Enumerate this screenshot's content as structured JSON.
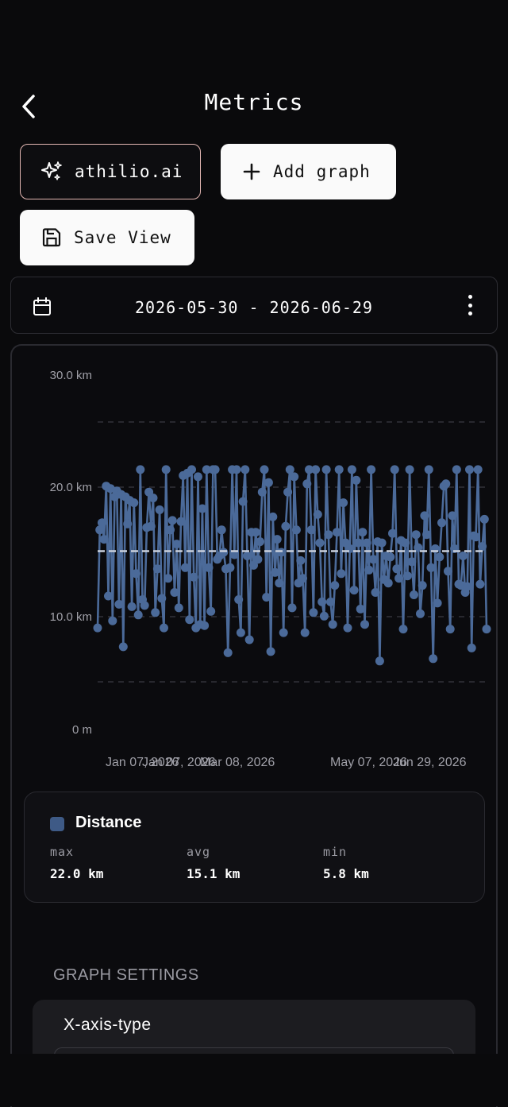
{
  "header": {
    "title": "Metrics",
    "back_icon": "chevron-left-icon"
  },
  "actions": {
    "ai_label": "athilio.ai",
    "ai_icon": "sparkles-icon",
    "add_graph_label": "Add graph",
    "add_icon": "plus-icon",
    "save_view_label": "Save View",
    "save_icon": "floppy-disk-icon"
  },
  "date_range": {
    "text": "2026-05-30 - 2026-06-29",
    "calendar_icon": "calendar-icon",
    "more_icon": "more-vertical-icon"
  },
  "chart_data": {
    "type": "line",
    "ylabel": "",
    "y_tick_labels": [
      "30.0 km",
      "20.0 km",
      "10.0 km",
      "0 m"
    ],
    "x_tick_labels": [
      "Jan 07, 2026",
      "Jan 07, 2026",
      "Mar 08, 2026",
      "May 07, 2026",
      "Jun 29, 2026"
    ],
    "ylim": [
      0,
      30
    ],
    "grid": "dashed horizontal",
    "average_line": 15.1,
    "series": [
      {
        "name": "Distance",
        "color": "#4b6a99",
        "values": [
          8.6,
          16.9,
          17.5,
          16.1,
          20.6,
          11.3,
          20.4,
          9.2,
          19.7,
          20.2,
          10.6,
          19.9,
          7.0,
          19.7,
          17.4,
          19.4,
          10.4,
          19.2,
          13.2,
          9.7,
          22.0,
          11.0,
          10.5,
          17.1,
          20.1,
          17.2,
          19.6,
          9.9,
          13.6,
          18.6,
          11.1,
          8.6,
          22.0,
          12.8,
          16.9,
          17.7,
          11.6,
          15.7,
          10.3,
          17.6,
          21.5,
          13.7,
          21.7,
          9.3,
          22.0,
          12.9,
          8.6,
          21.4,
          8.9,
          18.7,
          8.8,
          22.0,
          13.7,
          10.0,
          22.0,
          22.0,
          14.4,
          14.7,
          16.9,
          15.0,
          13.6,
          6.5,
          13.7,
          22.0,
          14.8,
          22.0,
          11.0,
          8.2,
          19.3,
          22.0,
          14.7,
          7.6,
          16.7,
          13.9,
          16.7,
          14.4,
          15.9,
          20.1,
          22.0,
          11.2,
          20.9,
          6.6,
          18.0,
          13.3,
          16.1,
          12.4,
          15.0,
          8.2,
          17.2,
          20.1,
          22.0,
          10.3,
          21.4,
          16.9,
          12.4,
          14.3,
          12.8,
          8.2,
          20.8,
          22.0,
          16.9,
          9.9,
          22.0,
          18.2,
          15.8,
          10.8,
          9.6,
          22.0,
          16.5,
          10.8,
          8.9,
          12.2,
          16.7,
          22.0,
          13.2,
          19.2,
          15.8,
          8.6,
          15.3,
          22.0,
          11.8,
          21.1,
          15.8,
          10.2,
          16.7,
          8.9,
          15.8,
          13.5,
          22.0,
          14.4,
          11.6,
          15.9,
          5.8,
          15.8,
          12.7,
          14.7,
          12.4,
          14.6,
          16.6,
          22.0,
          13.6,
          12.8,
          16.0,
          8.5,
          15.8,
          13.0,
          22.0,
          14.2,
          11.4,
          16.5,
          15.4,
          9.8,
          12.2,
          18.1,
          16.5,
          22.0,
          13.7,
          6.0,
          15.3,
          10.7,
          14.6,
          17.5,
          20.6,
          20.8,
          13.4,
          8.5,
          18.1,
          15.3,
          22.0,
          12.3,
          12.2,
          14.7,
          11.6,
          12.1,
          22.0,
          6.9,
          16.4,
          16.3,
          22.0,
          12.3,
          15.5,
          17.8,
          8.5
        ]
      }
    ]
  },
  "legend": {
    "name": "Distance",
    "color": "#3e5a86",
    "stats": [
      {
        "label": "max",
        "value": "22.0 km"
      },
      {
        "label": "avg",
        "value": "15.1 km"
      },
      {
        "label": "min",
        "value": "5.8 km"
      }
    ]
  },
  "settings": {
    "title": "GRAPH SETTINGS",
    "x_axis_label": "X-axis-type"
  }
}
